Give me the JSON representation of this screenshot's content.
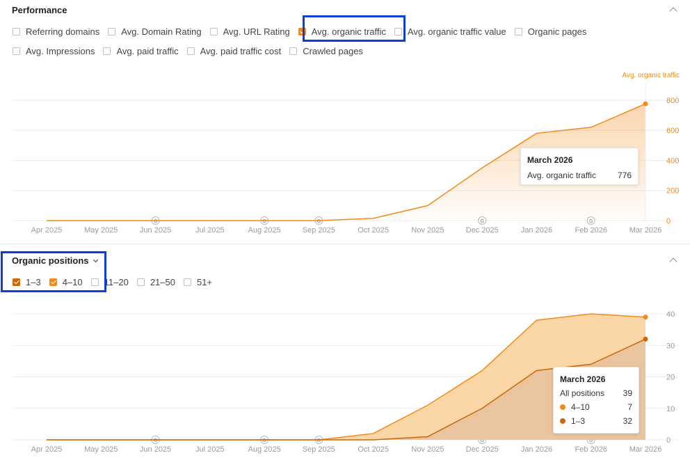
{
  "performance": {
    "title": "Performance",
    "checkbox_rows": [
      [
        {
          "label": "Referring domains",
          "checked": false
        },
        {
          "label": "Avg. Domain Rating",
          "checked": false
        },
        {
          "label": "Avg. URL Rating",
          "checked": false
        },
        {
          "label": "Avg. organic traffic",
          "checked": true
        },
        {
          "label": "Avg. organic traffic value",
          "checked": false
        },
        {
          "label": "Organic pages",
          "checked": false
        }
      ],
      [
        {
          "label": "Avg. Impressions",
          "checked": false
        },
        {
          "label": "Avg. paid traffic",
          "checked": false
        },
        {
          "label": "Avg. paid traffic cost",
          "checked": false
        },
        {
          "label": "Crawled pages",
          "checked": false
        }
      ]
    ],
    "tooltip": {
      "title": "March 2026",
      "label": "Avg. organic traffic",
      "value": "776"
    }
  },
  "organic_positions": {
    "title": "Organic positions",
    "checkboxes": [
      {
        "label": "1–3",
        "checked": true
      },
      {
        "label": "4–10",
        "checked": true
      },
      {
        "label": "11–20",
        "checked": false
      },
      {
        "label": "21–50",
        "checked": false
      },
      {
        "label": "51+",
        "checked": false
      }
    ],
    "tooltip": {
      "title": "March 2026",
      "total_label": "All positions",
      "total_value": "39",
      "rows": [
        {
          "label": "4–10",
          "value": "7"
        },
        {
          "label": "1–3",
          "value": "32"
        }
      ]
    }
  },
  "colors": {
    "accent": "#f28a17",
    "dark_orange": "#c9690a",
    "highlight": "#0a3ed6",
    "light_fill": "#fbd6a6",
    "dark_fill": "#e9c49d"
  },
  "chart_data": [
    {
      "type": "area",
      "series_label": "Avg. organic traffic",
      "x": [
        "Apr 2025",
        "May 2025",
        "Jun 2025",
        "Jul 2025",
        "Aug 2025",
        "Sep 2025",
        "Oct 2025",
        "Nov 2025",
        "Dec 2025",
        "Jan 2026",
        "Feb 2026",
        "Mar 2026"
      ],
      "series": [
        {
          "name": "Avg. organic traffic",
          "values": [
            0,
            0,
            0,
            0,
            0,
            0,
            15,
            100,
            350,
            580,
            620,
            776
          ]
        }
      ],
      "yticks": [
        0,
        200,
        400,
        600,
        800
      ],
      "ylim": [
        0,
        860
      ],
      "axis_position": "right",
      "google_update_markers": [
        "Jun 2025",
        "Aug 2025",
        "Sep 2025",
        "Dec 2025",
        "Feb 2026"
      ]
    },
    {
      "type": "area",
      "x": [
        "Apr 2025",
        "May 2025",
        "Jun 2025",
        "Jul 2025",
        "Aug 2025",
        "Sep 2025",
        "Oct 2025",
        "Nov 2025",
        "Dec 2025",
        "Jan 2026",
        "Feb 2026",
        "Mar 2026"
      ],
      "series": [
        {
          "name": "1–3",
          "values": [
            0,
            0,
            0,
            0,
            0,
            0,
            0,
            1,
            10,
            22,
            24,
            32
          ]
        },
        {
          "name": "4–10",
          "values": [
            0,
            0,
            0,
            0,
            0,
            0,
            2,
            10,
            12,
            16,
            16,
            7
          ]
        }
      ],
      "stacked_totals": [
        0,
        0,
        0,
        0,
        0,
        0,
        2,
        11,
        22,
        38,
        40,
        39
      ],
      "yticks": [
        0,
        10,
        20,
        30,
        40
      ],
      "ylim": [
        0,
        42
      ],
      "axis_position": "right",
      "google_update_markers": [
        "Jun 2025",
        "Aug 2025",
        "Sep 2025",
        "Dec 2025",
        "Feb 2026"
      ]
    }
  ]
}
